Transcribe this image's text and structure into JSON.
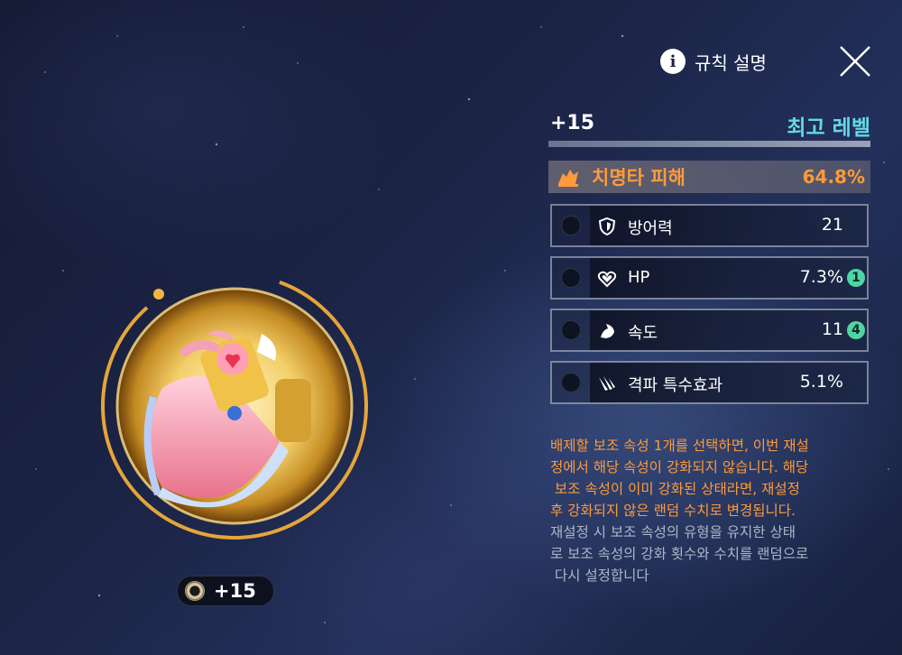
{
  "header": {
    "rules_label": "규칙 설명",
    "info_icon": "info-icon",
    "close_icon": "close-icon"
  },
  "level": {
    "current": "+15",
    "max_label": "최고 레벨",
    "progress": 1.0
  },
  "main_stat": {
    "icon": "crit-damage-icon",
    "name": "치명타 피해",
    "value": "64.8%"
  },
  "sub_stats": [
    {
      "icon": "shield-icon",
      "name": "방어력",
      "value": "21",
      "badge": ""
    },
    {
      "icon": "heart-icon",
      "name": "HP",
      "value": "7.3%",
      "badge": "1"
    },
    {
      "icon": "speed-icon",
      "name": "속도",
      "value": "11",
      "badge": "4"
    },
    {
      "icon": "claw-icon",
      "name": "격파 특수효과",
      "value": "5.1%",
      "badge": ""
    }
  ],
  "description": {
    "orange_lines": [
      "배제할 보조 속성 1개를 선택하면, 이번 재설",
      "정에서 해당 속성이 강화되지 않습니다. 해당",
      " 보조 속성이 이미 강화된 상태라면, 재설정",
      "후 강화되지 않은 랜덤 수치로 변경됩니다."
    ],
    "gray_lines": [
      "재설정 시 보조 속성의 유형을 유지한 상태",
      "로 보조 속성의 강화 횟수와 수치를 랜덤으로",
      " 다시 설정합니다"
    ]
  },
  "equipment": {
    "level_label": "+15"
  },
  "colors": {
    "accent_orange": "#ff9a3a",
    "accent_cyan": "#62d9e6",
    "badge_green": "#4fd5a4"
  }
}
